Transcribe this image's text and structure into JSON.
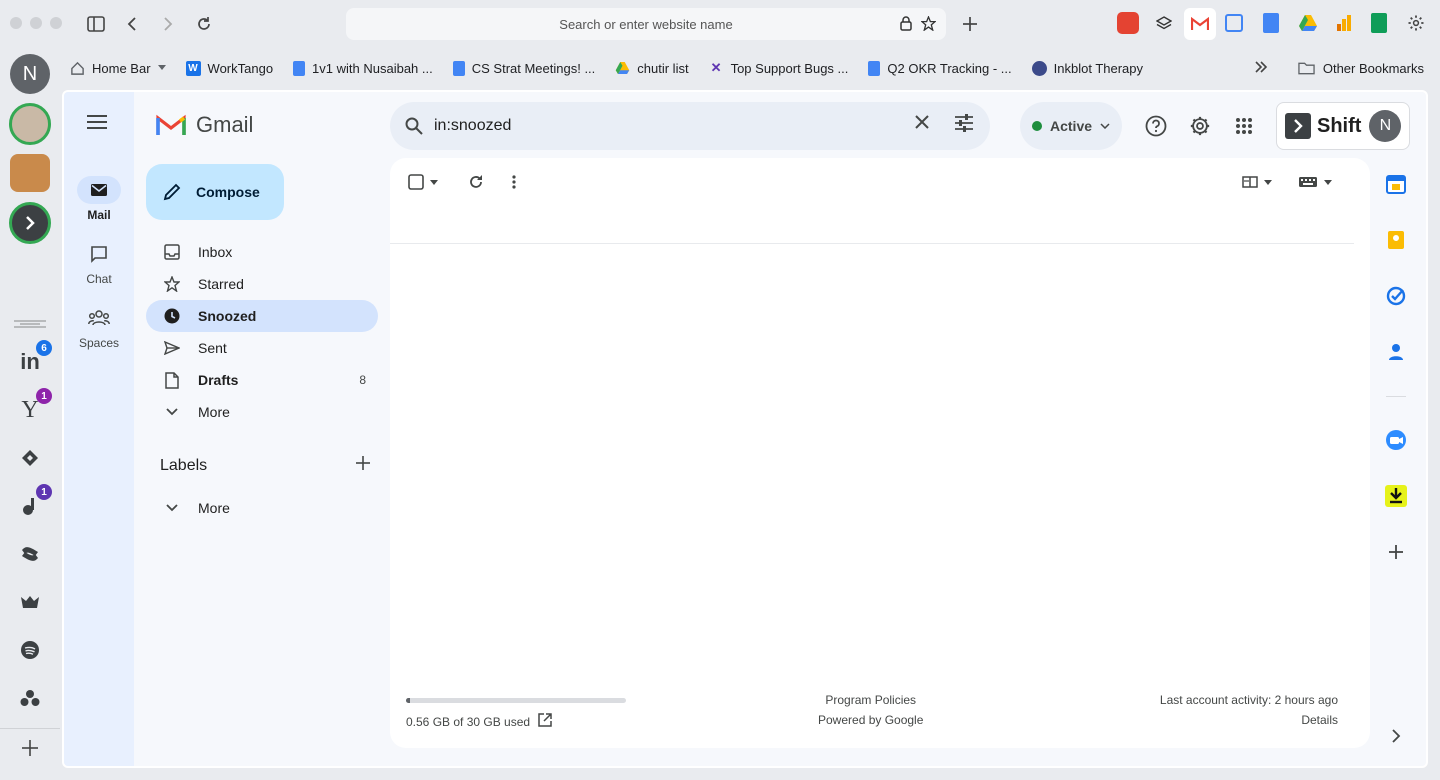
{
  "browser": {
    "url_placeholder": "Search or enter website name",
    "icons": [
      "sidebar-icon",
      "back-icon",
      "forward-icon",
      "reload-icon",
      "lock-icon",
      "star-icon",
      "new-tab-icon"
    ]
  },
  "bookmarks": {
    "items": [
      {
        "label": "Home Bar",
        "icon": "home-icon",
        "color": "#5f6368"
      },
      {
        "label": "WorkTango",
        "icon": "worktango-icon",
        "color": "#1a73e8"
      },
      {
        "label": "1v1 with Nusaibah ...",
        "icon": "docs-icon",
        "color": "#4285f4"
      },
      {
        "label": "CS Strat Meetings! ...",
        "icon": "docs-icon",
        "color": "#4285f4"
      },
      {
        "label": "chutir list",
        "icon": "drive-icon",
        "color": "#34a853"
      },
      {
        "label": "Top Support Bugs ...",
        "icon": "linear-icon",
        "color": "#5e35b1"
      },
      {
        "label": "Q2 OKR Tracking - ...",
        "icon": "docs-icon",
        "color": "#4285f4"
      },
      {
        "label": "Inkblot Therapy",
        "icon": "inkblot-icon",
        "color": "#3c4a8a"
      }
    ],
    "other": "Other Bookmarks"
  },
  "dock": {
    "account_initial": "N",
    "badges": {
      "linkedin": "6",
      "yahoo": "1",
      "app": "1"
    }
  },
  "gmail": {
    "logo_text": "Gmail",
    "rail": [
      {
        "label": "Mail",
        "icon": "mail-icon",
        "active": true
      },
      {
        "label": "Chat",
        "icon": "chat-icon",
        "active": false
      },
      {
        "label": "Spaces",
        "icon": "spaces-icon",
        "active": false
      }
    ],
    "compose_label": "Compose",
    "nav": [
      {
        "label": "Inbox",
        "icon": "inbox-icon",
        "count": ""
      },
      {
        "label": "Starred",
        "icon": "star-icon",
        "count": ""
      },
      {
        "label": "Snoozed",
        "icon": "clock-icon",
        "count": ""
      },
      {
        "label": "Sent",
        "icon": "send-icon",
        "count": ""
      },
      {
        "label": "Drafts",
        "icon": "draft-icon",
        "count": "8"
      },
      {
        "label": "More",
        "icon": "chevron-down-icon",
        "count": ""
      }
    ],
    "labels_heading": "Labels",
    "labels_more": "More",
    "search_value": "in:snoozed",
    "status": "Active",
    "status_color": "#1e8e3e",
    "shift_label": "Shift",
    "avatar_initial": "N",
    "storage": {
      "used_text": "0.56 GB of 30 GB used",
      "fraction": 0.019
    },
    "footer_center": {
      "line1": "Program Policies",
      "line2": "Powered by Google"
    },
    "footer_right": {
      "line1": "Last account activity: 2 hours ago",
      "line2": "Details"
    }
  }
}
